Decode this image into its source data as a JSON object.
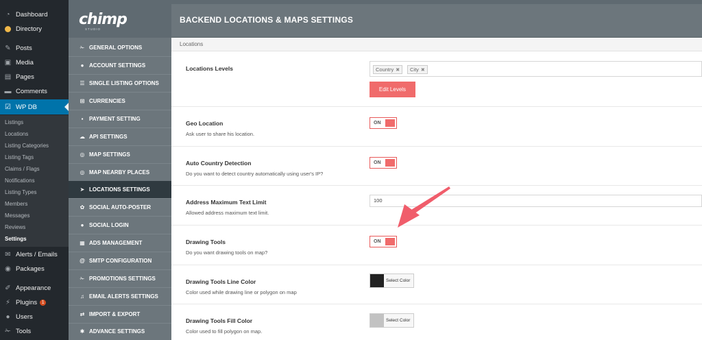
{
  "wp_sidebar": {
    "top_items": [
      {
        "label": "Dashboard",
        "icon": "dashboard-icon"
      },
      {
        "label": "Directory",
        "icon": "directory-icon"
      },
      {
        "label": "Posts",
        "icon": "pin-icon"
      },
      {
        "label": "Media",
        "icon": "media-icon"
      },
      {
        "label": "Pages",
        "icon": "pages-icon"
      },
      {
        "label": "Comments",
        "icon": "comment-icon"
      },
      {
        "label": "WP DB",
        "icon": "wpdb-icon"
      }
    ],
    "sub_items": [
      "Listings",
      "Locations",
      "Listing Categories",
      "Listing Tags",
      "Claims / Flags",
      "Notifications",
      "Listing Types",
      "Members",
      "Messages",
      "Reviews",
      "Settings"
    ],
    "bottom_items": [
      {
        "label": "Alerts / Emails",
        "icon": "mail-icon"
      },
      {
        "label": "Packages",
        "icon": "package-icon"
      },
      {
        "label": "Appearance",
        "icon": "brush-icon"
      },
      {
        "label": "Plugins",
        "icon": "plugin-icon",
        "badge": "1"
      },
      {
        "label": "Users",
        "icon": "user-icon"
      },
      {
        "label": "Tools",
        "icon": "wrench-icon"
      }
    ]
  },
  "logo": {
    "text": "chimp",
    "sub": "STUDIO"
  },
  "plugin_nav": [
    {
      "label": "GENERAL OPTIONS",
      "icon": "wrench-icon"
    },
    {
      "label": "ACCOUNT SETTINGS",
      "icon": "user-icon"
    },
    {
      "label": "SINGLE LISTING OPTIONS",
      "icon": "list-icon"
    },
    {
      "label": "CURRENCIES",
      "icon": "currency-icon"
    },
    {
      "label": "PAYMENT SETTING",
      "icon": "card-icon"
    },
    {
      "label": "API SETTINGS",
      "icon": "cloud-icon"
    },
    {
      "label": "MAP SETTINGS",
      "icon": "map-icon"
    },
    {
      "label": "MAP NEARBY PLACES",
      "icon": "target-icon"
    },
    {
      "label": "LOCATIONS SETTINGS",
      "icon": "location-arrow-icon"
    },
    {
      "label": "SOCIAL AUTO-POSTER",
      "icon": "share-icon"
    },
    {
      "label": "SOCIAL LOGIN",
      "icon": "user-icon"
    },
    {
      "label": "ADS MANAGEMENT",
      "icon": "ad-icon"
    },
    {
      "label": "SMTP CONFIGURATION",
      "icon": "at-icon"
    },
    {
      "label": "PROMOTIONS SETTINGS",
      "icon": "wrench-icon"
    },
    {
      "label": "EMAIL ALERTS SETTINGS",
      "icon": "bell-icon"
    },
    {
      "label": "IMPORT & EXPORT",
      "icon": "import-icon"
    },
    {
      "label": "ADVANCE SETTINGS",
      "icon": "gear-icon"
    }
  ],
  "page_title": "BACKEND LOCATIONS & MAPS SETTINGS",
  "section": "Locations",
  "rows": {
    "levels": {
      "label": "Locations Levels",
      "tags": [
        "Country",
        "City"
      ],
      "button": "Edit Levels"
    },
    "geo": {
      "label": "Geo Location",
      "desc": "Ask user to share his location.",
      "toggle": "ON"
    },
    "auto_country": {
      "label": "Auto Country Detection",
      "desc": "Do you want to detect country automatically using user's IP?",
      "toggle": "ON"
    },
    "address_limit": {
      "label": "Address Maximum Text Limit",
      "desc": "Allowed address maximum text limit.",
      "value": "100"
    },
    "drawing": {
      "label": "Drawing Tools",
      "desc": "Do you want drawing tools on map?",
      "toggle": "ON"
    },
    "line_color": {
      "label": "Drawing Tools Line Color",
      "desc": "Color used while drawing line or polygon on map",
      "button": "Select Color",
      "color": "#222222"
    },
    "fill_color": {
      "label": "Drawing Tools Fill Color",
      "desc": "Color used to fill polygon on map.",
      "button": "Select Color",
      "color": "#c2c2c2"
    }
  },
  "colors": {
    "accent": "#f06b6b",
    "wp_active": "#0073aa",
    "arrow": "#f05d6b"
  }
}
